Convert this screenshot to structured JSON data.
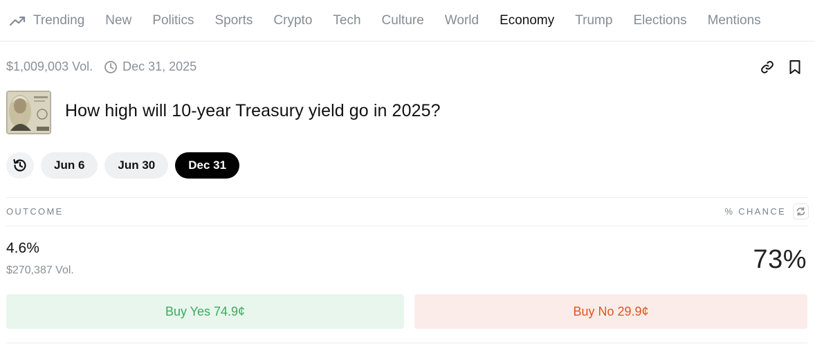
{
  "nav": {
    "items": [
      {
        "label": "Trending",
        "icon": "trending-icon"
      },
      {
        "label": "New"
      },
      {
        "label": "Politics"
      },
      {
        "label": "Sports"
      },
      {
        "label": "Crypto"
      },
      {
        "label": "Tech"
      },
      {
        "label": "Culture"
      },
      {
        "label": "World"
      },
      {
        "label": "Economy",
        "active": true
      },
      {
        "label": "Trump"
      },
      {
        "label": "Elections"
      },
      {
        "label": "Mentions"
      }
    ]
  },
  "market": {
    "volume": "$1,009,003 Vol.",
    "end_date": "Dec 31, 2025",
    "title": "How high will 10-year Treasury yield go in 2025?",
    "thumbnail_icon": "twenty-dollar-bill-image"
  },
  "dates": {
    "history_icon": "history-icon",
    "options": [
      {
        "label": "Jun 6"
      },
      {
        "label": "Jun 30"
      },
      {
        "label": "Dec 31",
        "active": true
      }
    ]
  },
  "table": {
    "outcome_header": "OUTCOME",
    "chance_header": "% CHANCE",
    "rows": [
      {
        "outcome": "4.6%",
        "volume": "$270,387 Vol.",
        "chance": "73%",
        "buy_yes": "Buy Yes 74.9¢",
        "buy_no": "Buy No 29.9¢"
      }
    ]
  },
  "colors": {
    "yes_text": "#3bab5b",
    "yes_bg": "#e8f6ed",
    "no_text": "#e0541f",
    "no_bg": "#fbecea",
    "active_pill": "#000000"
  }
}
